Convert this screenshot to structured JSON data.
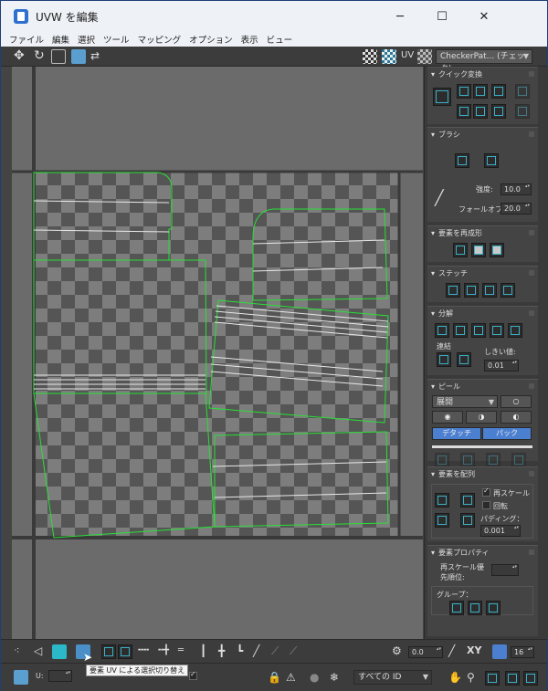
{
  "window": {
    "title": "UVW を編集",
    "minimize": "─",
    "maximize": "☐",
    "close": "✕"
  },
  "menu": [
    "ファイル",
    "編集",
    "選択",
    "ツール",
    "マッピング",
    "オプション",
    "表示",
    "ビュー"
  ],
  "toolbar": {
    "uv_label": "UV",
    "texture_combo": "CheckerPat... (チェック)"
  },
  "panel": {
    "quick_transform": {
      "title": "クイック変換"
    },
    "brush": {
      "title": "ブラシ",
      "strength_label": "強度:",
      "strength_value": "10.0",
      "falloff_label": "フォールオフ:",
      "falloff_value": "20.0"
    },
    "reshape": {
      "title": "要素を再成形"
    },
    "stitch": {
      "title": "ステッチ"
    },
    "explode": {
      "title": "分解",
      "weld_label": "連結",
      "threshold_label": "しきい値:",
      "threshold_value": "0.01"
    },
    "peel": {
      "title": "ピール",
      "mode_value": "展開",
      "detach_button": "デタッチ",
      "pack_button": "パック"
    },
    "arrange": {
      "title": "要素を配列",
      "rescale_label": "再スケール",
      "rotate_label": "回転",
      "padding_label": "パディング：",
      "padding_value": "0.001"
    },
    "properties": {
      "title": "要素プロパティ",
      "priority_label": "再スケール優",
      "priority_label2": "先順位:",
      "groups_label": "グループ："
    }
  },
  "bottom": {
    "angle_value": "0.0",
    "xy_label": "XY",
    "grid_value": "16",
    "u_label": "U:",
    "id_combo": "すべての ID",
    "tooltip": "要素 UV による選択切り替え"
  },
  "colors": {
    "viewport_bg": "#6b6b6b",
    "checker_dark": "#555555",
    "checker_light": "#7d7d7d",
    "uv_outline": "#29e036",
    "accent_blue": "#4b7fd0"
  }
}
